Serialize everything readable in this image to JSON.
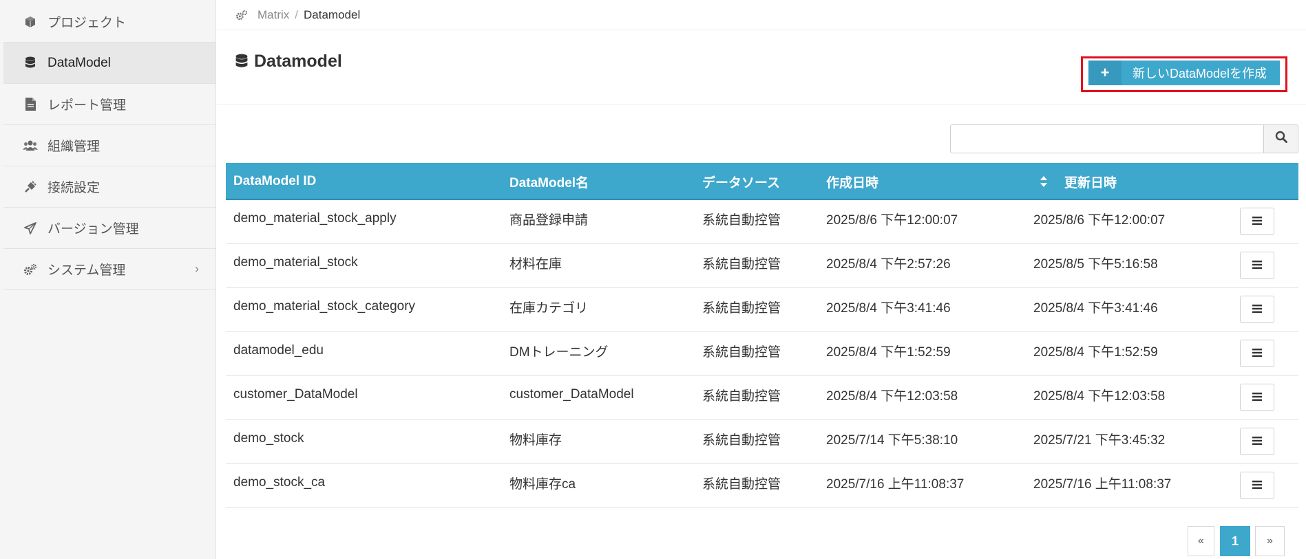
{
  "sidebar": {
    "items": [
      {
        "label": "プロジェクト",
        "icon": "cube-icon"
      },
      {
        "label": "DataModel",
        "icon": "database-icon"
      },
      {
        "label": "レポート管理",
        "icon": "file-icon"
      },
      {
        "label": "組織管理",
        "icon": "users-icon"
      },
      {
        "label": "接続設定",
        "icon": "plug-icon"
      },
      {
        "label": "バージョン管理",
        "icon": "paper-plane-icon"
      },
      {
        "label": "システム管理",
        "icon": "gears-icon",
        "chevron": "›"
      }
    ]
  },
  "breadcrumb": {
    "root": "Matrix",
    "separator": "/",
    "current": "Datamodel"
  },
  "header": {
    "title": "Datamodel",
    "create_button": "新しいDataModelを作成",
    "create_icon": "+"
  },
  "search": {
    "value": "",
    "placeholder": ""
  },
  "table": {
    "columns": [
      "DataModel ID",
      "DataModel名",
      "データソース",
      "作成日時",
      "更新日時"
    ],
    "rows": [
      {
        "id": "demo_material_stock_apply",
        "name": "商品登録申請",
        "source": "系統自動控管",
        "created": "2025/8/6 下午12:00:07",
        "updated": "2025/8/6 下午12:00:07"
      },
      {
        "id": "demo_material_stock",
        "name": "材料在庫",
        "source": "系統自動控管",
        "created": "2025/8/4 下午2:57:26",
        "updated": "2025/8/5 下午5:16:58"
      },
      {
        "id": "demo_material_stock_category",
        "name": "在庫カテゴリ",
        "source": "系統自動控管",
        "created": "2025/8/4 下午3:41:46",
        "updated": "2025/8/4 下午3:41:46"
      },
      {
        "id": "datamodel_edu",
        "name": "DMトレーニング",
        "source": "系統自動控管",
        "created": "2025/8/4 下午1:52:59",
        "updated": "2025/8/4 下午1:52:59"
      },
      {
        "id": "customer_DataModel",
        "name": "customer_DataModel",
        "source": "系統自動控管",
        "created": "2025/8/4 下午12:03:58",
        "updated": "2025/8/4 下午12:03:58"
      },
      {
        "id": "demo_stock",
        "name": "物料庫存",
        "source": "系統自動控管",
        "created": "2025/7/14 下午5:38:10",
        "updated": "2025/7/21 下午3:45:32"
      },
      {
        "id": "demo_stock_ca",
        "name": "物料庫存ca",
        "source": "系統自動控管",
        "created": "2025/7/16 上午11:08:37",
        "updated": "2025/7/16 上午11:08:37"
      }
    ]
  },
  "pagination": {
    "prev": "«",
    "current": "1",
    "next": "»"
  },
  "colors": {
    "accent": "#3ea7cc",
    "highlight": "#e3101b"
  }
}
